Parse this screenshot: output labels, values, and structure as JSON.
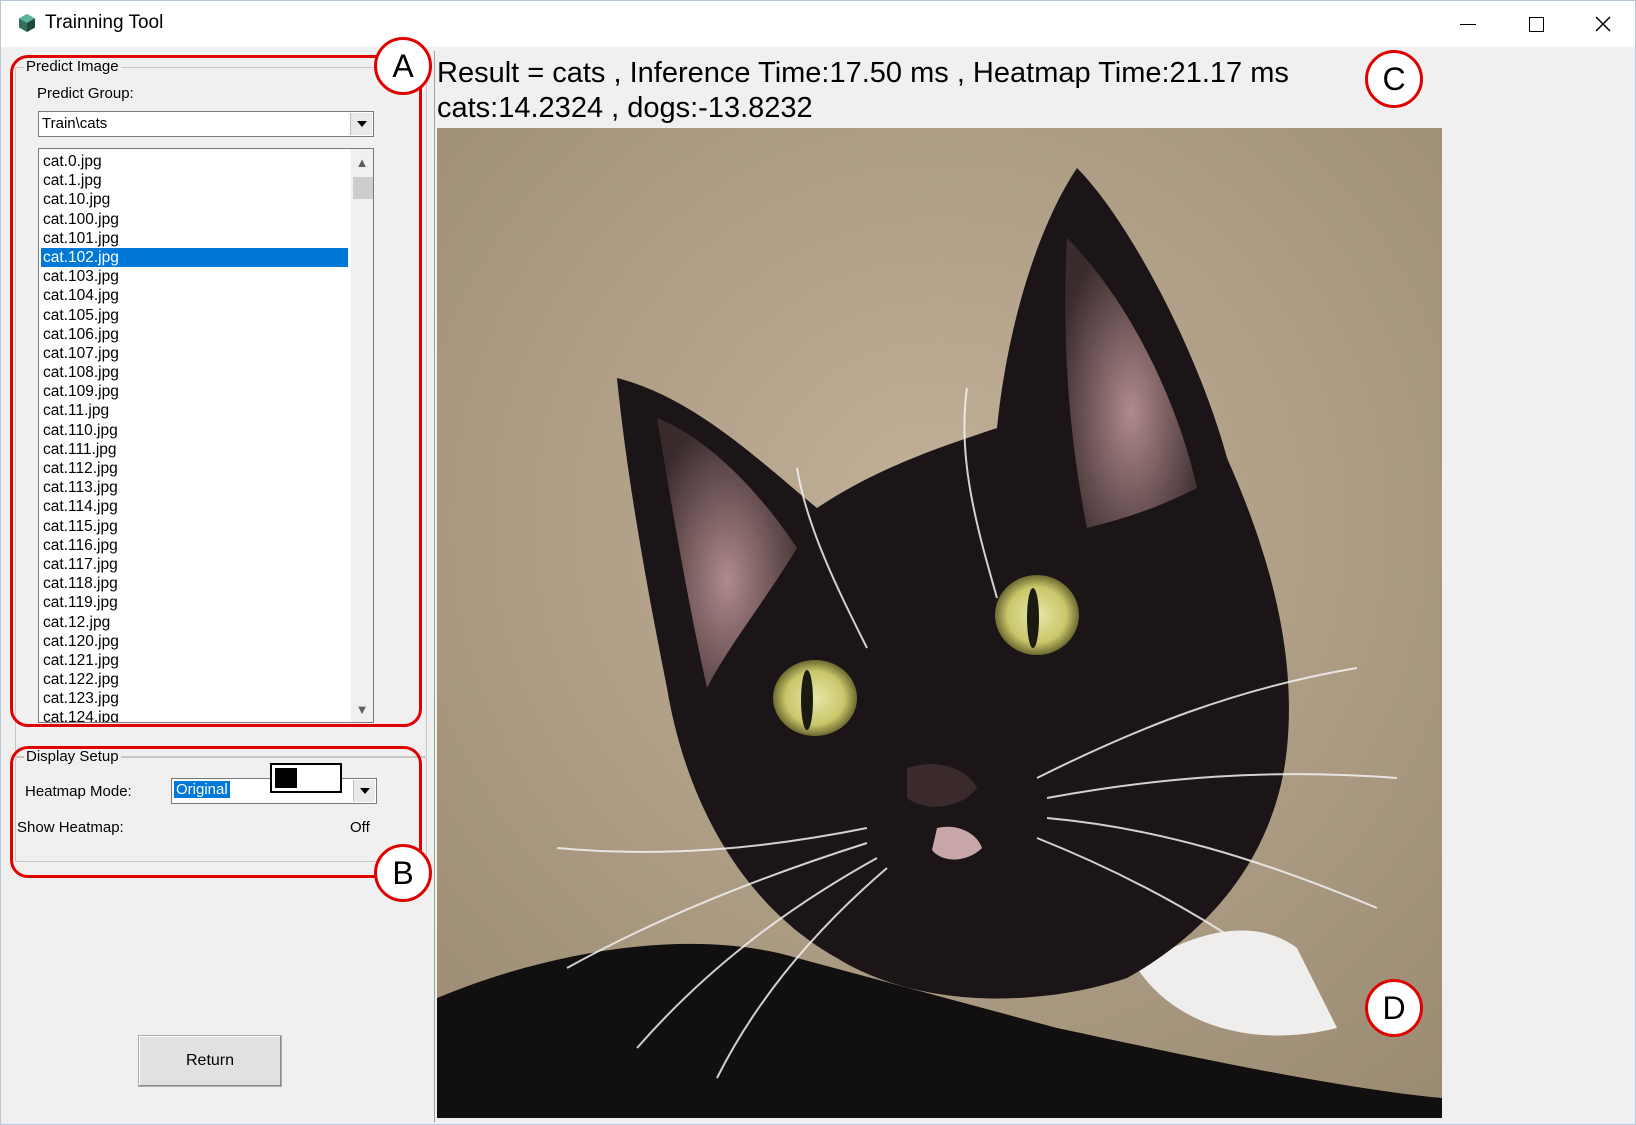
{
  "window": {
    "title": "Trainning Tool"
  },
  "predict_image": {
    "group_title": "Predict Image",
    "group_label": "Predict Group:",
    "group_value": "Train\\cats",
    "files": [
      "cat.0.jpg",
      "cat.1.jpg",
      "cat.10.jpg",
      "cat.100.jpg",
      "cat.101.jpg",
      "cat.102.jpg",
      "cat.103.jpg",
      "cat.104.jpg",
      "cat.105.jpg",
      "cat.106.jpg",
      "cat.107.jpg",
      "cat.108.jpg",
      "cat.109.jpg",
      "cat.11.jpg",
      "cat.110.jpg",
      "cat.111.jpg",
      "cat.112.jpg",
      "cat.113.jpg",
      "cat.114.jpg",
      "cat.115.jpg",
      "cat.116.jpg",
      "cat.117.jpg",
      "cat.118.jpg",
      "cat.119.jpg",
      "cat.12.jpg",
      "cat.120.jpg",
      "cat.121.jpg",
      "cat.122.jpg",
      "cat.123.jpg",
      "cat.124.jpg"
    ],
    "selected_file": "cat.102.jpg"
  },
  "display_setup": {
    "group_title": "Display Setup",
    "heatmap_mode_label": "Heatmap Mode:",
    "heatmap_mode_value": "Original",
    "show_heatmap_label": "Show Heatmap:",
    "show_heatmap_state": "Off"
  },
  "return_label": "Return",
  "result": {
    "line1": "Result = cats , Inference Time:17.50 ms , Heatmap Time:21.17 ms",
    "line2": "cats:14.2324 , dogs:-13.8232"
  },
  "callouts": {
    "a": "A",
    "b": "B",
    "c": "C",
    "d": "D"
  },
  "colors": {
    "selection": "#0078d7",
    "callout": "#e00000",
    "window_bg": "#f0f0f0"
  }
}
